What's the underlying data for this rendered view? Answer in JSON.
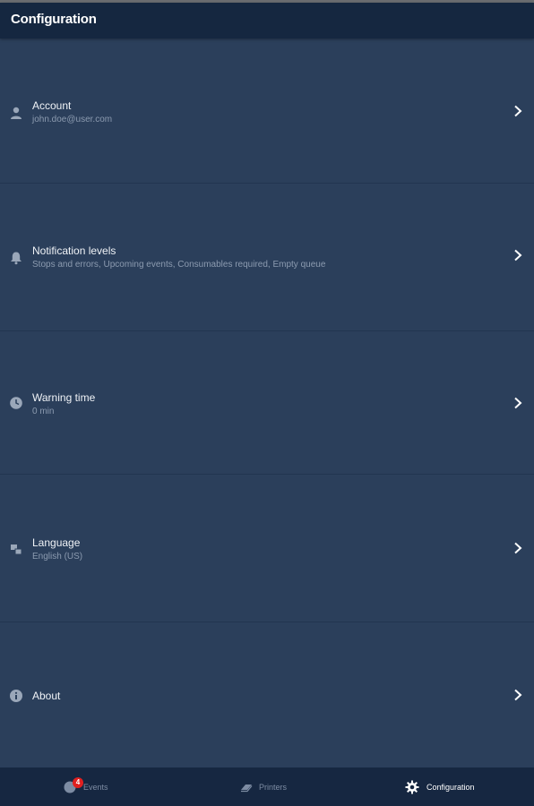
{
  "header": {
    "title": "Configuration"
  },
  "settings": [
    {
      "id": "account",
      "title": "Account",
      "subtitle": "john.doe@user.com",
      "icon": "person-icon"
    },
    {
      "id": "notifications",
      "title": "Notification levels",
      "subtitle": "Stops and errors, Upcoming events, Consumables required, Empty queue",
      "icon": "bell-icon"
    },
    {
      "id": "warning-time",
      "title": "Warning time",
      "subtitle": "0 min",
      "icon": "clock-icon"
    },
    {
      "id": "language",
      "title": "Language",
      "subtitle": "English (US)",
      "icon": "language-icon"
    },
    {
      "id": "about",
      "title": "About",
      "subtitle": "",
      "icon": "info-icon"
    }
  ],
  "bottom_nav": {
    "items": [
      {
        "label": "Events",
        "badge": "4",
        "icon": "events-icon",
        "active": false
      },
      {
        "label": "Printers",
        "icon": "printers-icon",
        "active": false
      },
      {
        "label": "Configuration",
        "icon": "gear-icon",
        "active": true
      }
    ]
  },
  "colors": {
    "background": "#2b3f5b",
    "header": "#152740",
    "bottom_nav": "#162741",
    "badge": "#e02020",
    "inactive_nav": "#7d8ca3",
    "active_nav": "#ffffff"
  }
}
